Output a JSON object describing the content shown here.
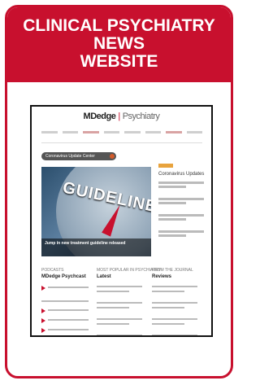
{
  "banner": {
    "line1": "CLINICAL PSYCHIATRY",
    "line2": "NEWS",
    "line3": "WEBSITE"
  },
  "site": {
    "logo_brand": "MDedge",
    "logo_section": "Psychiatry",
    "covid_pill": "Coronavirus Update Center",
    "hero_word": "GUIDELINES",
    "hero_caption": "Jump in new treatment guideline released",
    "side_title": "Coronavirus Updates",
    "col1_head": "PODCASTS",
    "col1_title": "MDedge Psychcast",
    "col2_head": "MOST POPULAR IN PSYCHIATRY",
    "col2_title": "Latest",
    "col3_head": "FROM THE JOURNAL",
    "col3_title": "Reviews"
  },
  "colors": {
    "brand_red": "#c8102e"
  }
}
